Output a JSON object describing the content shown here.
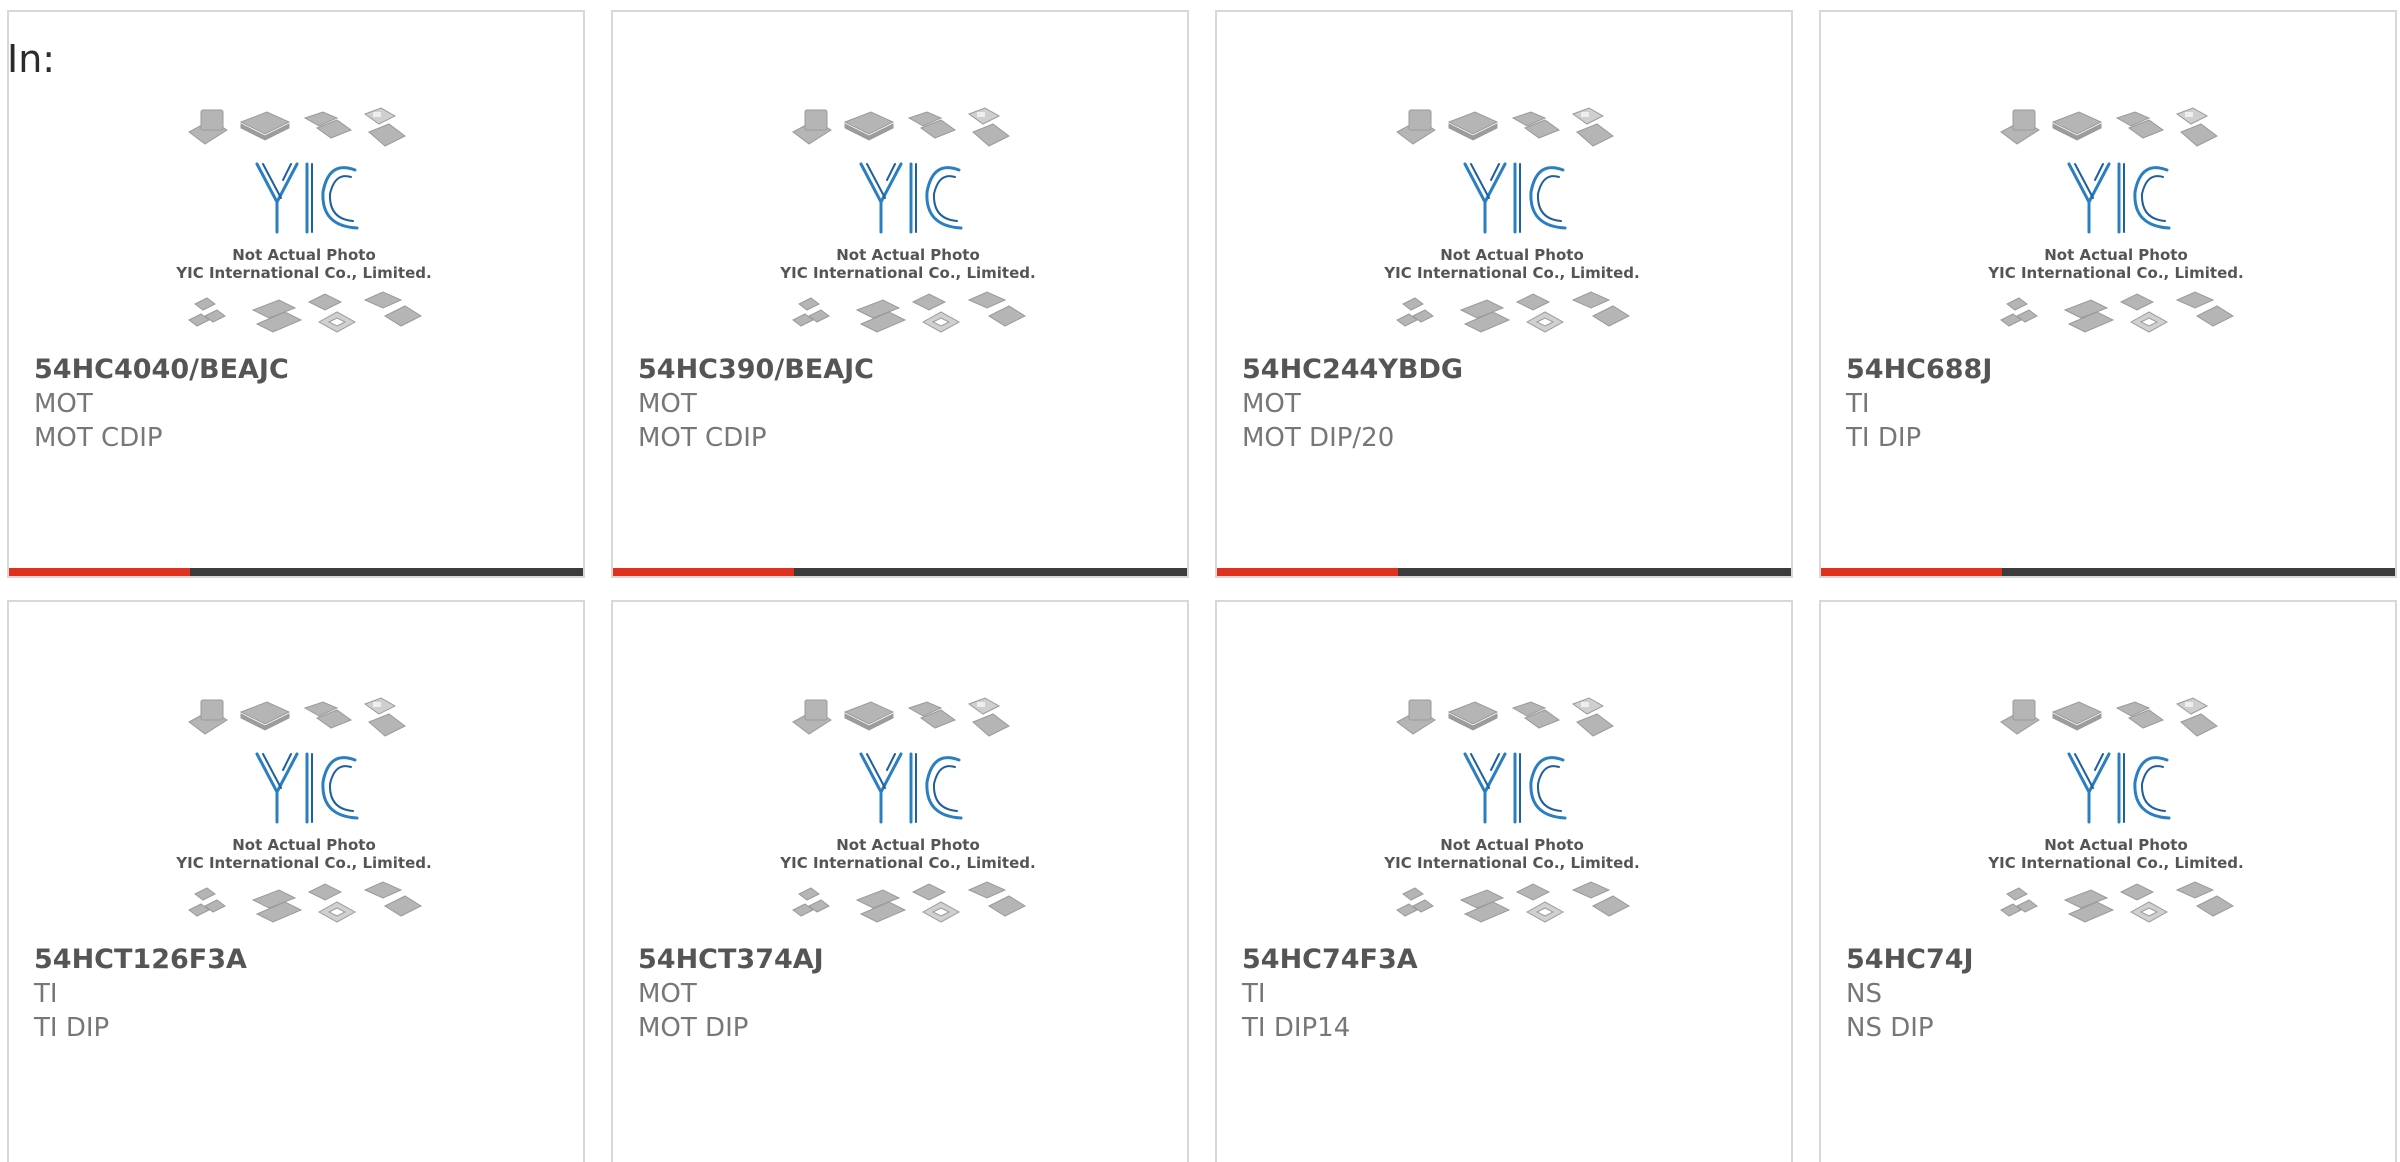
{
  "heading": "In:",
  "photo_caption": {
    "line1": "Not Actual Photo",
    "line2": "YIC International Co., Limited.",
    "logo_text": "YIC"
  },
  "colors": {
    "accent": "#e0301e",
    "bar_dark": "#3c3c3c",
    "logo_blue": "#2a7fc0"
  },
  "products": [
    {
      "part": "54HC4040/BEAJC",
      "brand": "MOT",
      "package": "MOT CDIP",
      "bar_fill": 0.315
    },
    {
      "part": "54HC390/BEAJC",
      "brand": "MOT",
      "package": "MOT CDIP",
      "bar_fill": 0.315
    },
    {
      "part": "54HC244YBDG",
      "brand": "MOT",
      "package": "MOT DIP/20",
      "bar_fill": 0.315
    },
    {
      "part": "54HC688J",
      "brand": "TI",
      "package": "TI DIP",
      "bar_fill": 0.315
    },
    {
      "part": "54HCT126F3A",
      "brand": "TI",
      "package": "TI DIP"
    },
    {
      "part": "54HCT374AJ",
      "brand": "MOT",
      "package": "MOT DIP"
    },
    {
      "part": "54HC74F3A",
      "brand": "TI",
      "package": "TI DIP14"
    },
    {
      "part": "54HC74J",
      "brand": "NS",
      "package": "NS DIP"
    }
  ]
}
